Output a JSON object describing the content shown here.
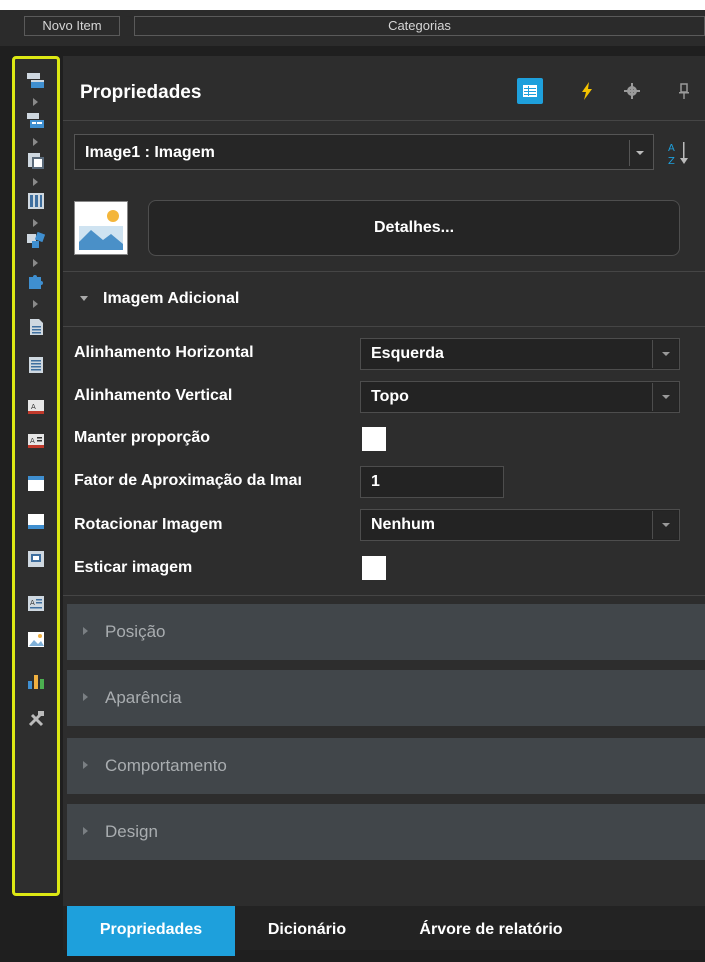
{
  "top_tabs": {
    "new_item": "Novo Item",
    "categories": "Categorias"
  },
  "toolbox": {
    "items": [
      "report-band-icon",
      "data-band-icon",
      "cross-band-icon",
      "table-icon",
      "components-icon",
      "puzzle-icon",
      "page-header-icon",
      "text-lines-icon",
      "text-box-icon",
      "rich-text-icon",
      "panel-icon",
      "panel-alt-icon",
      "subreport-icon",
      "text-field-icon",
      "image-icon",
      "chart-icon",
      "tools-icon"
    ],
    "border_color": "#dce814"
  },
  "panel": {
    "title": "Propriedades",
    "header_icons": [
      "properties-grid-icon",
      "events-lightning-icon",
      "settings-gear-icon",
      "pin-icon"
    ],
    "sort_icon": "sort-az-icon",
    "selector": {
      "value": "Image1 : Imagem"
    },
    "details_button": "Detalhes...",
    "section": {
      "title": "Imagem Adicional",
      "props": {
        "horizontal_alignment": {
          "label": "Alinhamento Horizontal",
          "value": "Esquerda"
        },
        "vertical_alignment": {
          "label": "Alinhamento Vertical",
          "value": "Topo"
        },
        "keep_ratio": {
          "label": "Manter proporção",
          "checked": false
        },
        "zoom_factor": {
          "label": "Fator de Aproximação da Imaı",
          "value": "1"
        },
        "rotate": {
          "label": "Rotacionar Imagem",
          "value": "Nenhum"
        },
        "stretch": {
          "label": "Esticar imagem",
          "checked": false
        }
      }
    },
    "categories": [
      "Posição",
      "Aparência",
      "Comportamento",
      "Design"
    ]
  },
  "bottom_tabs": {
    "tabs": [
      "Propriedades",
      "Dicionário",
      "Árvore de relatório"
    ],
    "active": 0
  },
  "colors": {
    "accent": "#1ea0dc",
    "panel_bg": "#2d2d2d",
    "category_bg": "#41464a"
  }
}
